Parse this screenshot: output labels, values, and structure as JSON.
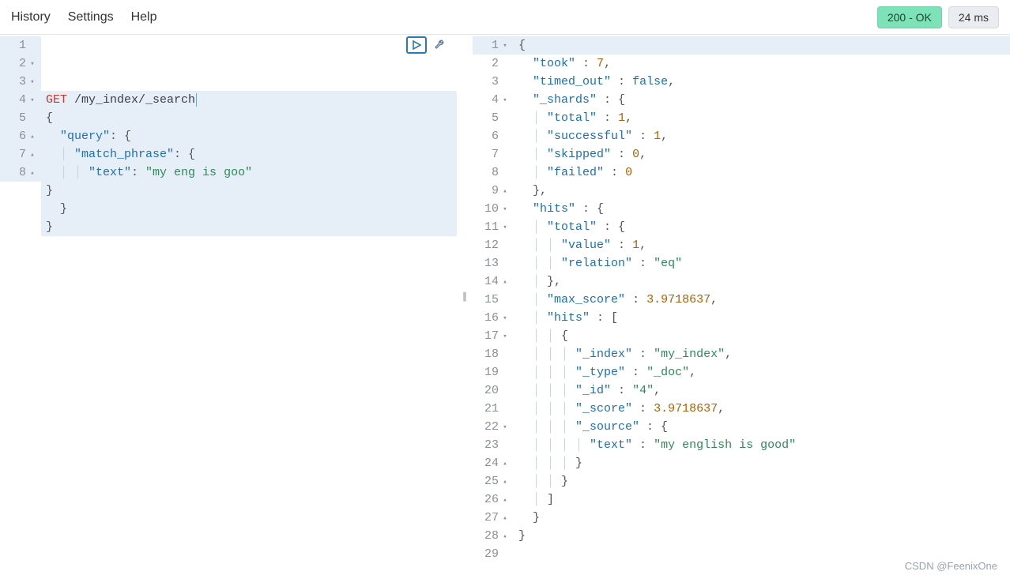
{
  "menu": {
    "history": "History",
    "settings": "Settings",
    "help": "Help"
  },
  "status": {
    "code_label": "200 - OK",
    "time_label": "24 ms"
  },
  "watermark": "CSDN @FeenixOne",
  "request": {
    "method": "GET",
    "path": "/my_index/_search",
    "body_lines": [
      {
        "n": 1,
        "fold": "",
        "hl": true
      },
      {
        "n": 2,
        "fold": "▾",
        "hl": true,
        "text_plain": "{"
      },
      {
        "n": 3,
        "fold": "▾",
        "hl": true,
        "key": "\"query\"",
        "after": ": {"
      },
      {
        "n": 4,
        "fold": "▾",
        "hl": true,
        "indent": 1,
        "key": "\"match_phrase\"",
        "after": ": {"
      },
      {
        "n": 5,
        "fold": "",
        "hl": true,
        "indent": 2,
        "key": "\"text\"",
        "mid": ": ",
        "str": "\"my eng is goo\""
      },
      {
        "n": 6,
        "fold": "▴",
        "hl": true,
        "indent": 1,
        "text_plain": "}"
      },
      {
        "n": 7,
        "fold": "▴",
        "hl": true,
        "text_plain": "  }"
      },
      {
        "n": 8,
        "fold": "▴",
        "hl": true,
        "text_plain": "}"
      }
    ]
  },
  "response": {
    "lines": [
      {
        "n": 1,
        "fold": "▾",
        "hl": true,
        "raw": [
          [
            "punc",
            "{"
          ]
        ]
      },
      {
        "n": 2,
        "fold": "",
        "raw": [
          [
            "punc",
            "  "
          ],
          [
            "key",
            "\"took\""
          ],
          [
            "punc",
            " : "
          ],
          [
            "num",
            "7"
          ],
          [
            "punc",
            ","
          ]
        ]
      },
      {
        "n": 3,
        "fold": "",
        "raw": [
          [
            "punc",
            "  "
          ],
          [
            "key",
            "\"timed_out\""
          ],
          [
            "punc",
            " : "
          ],
          [
            "bool",
            "false"
          ],
          [
            "punc",
            ","
          ]
        ]
      },
      {
        "n": 4,
        "fold": "▾",
        "raw": [
          [
            "punc",
            "  "
          ],
          [
            "key",
            "\"_shards\""
          ],
          [
            "punc",
            " : {"
          ]
        ]
      },
      {
        "n": 5,
        "fold": "",
        "raw": [
          [
            "punc",
            "    "
          ],
          [
            "key",
            "\"total\""
          ],
          [
            "punc",
            " : "
          ],
          [
            "num",
            "1"
          ],
          [
            "punc",
            ","
          ]
        ]
      },
      {
        "n": 6,
        "fold": "",
        "raw": [
          [
            "punc",
            "    "
          ],
          [
            "key",
            "\"successful\""
          ],
          [
            "punc",
            " : "
          ],
          [
            "num",
            "1"
          ],
          [
            "punc",
            ","
          ]
        ]
      },
      {
        "n": 7,
        "fold": "",
        "raw": [
          [
            "punc",
            "    "
          ],
          [
            "key",
            "\"skipped\""
          ],
          [
            "punc",
            " : "
          ],
          [
            "num",
            "0"
          ],
          [
            "punc",
            ","
          ]
        ]
      },
      {
        "n": 8,
        "fold": "",
        "raw": [
          [
            "punc",
            "    "
          ],
          [
            "key",
            "\"failed\""
          ],
          [
            "punc",
            " : "
          ],
          [
            "num",
            "0"
          ]
        ]
      },
      {
        "n": 9,
        "fold": "▴",
        "raw": [
          [
            "punc",
            "  },"
          ]
        ]
      },
      {
        "n": 10,
        "fold": "▾",
        "raw": [
          [
            "punc",
            "  "
          ],
          [
            "key",
            "\"hits\""
          ],
          [
            "punc",
            " : {"
          ]
        ]
      },
      {
        "n": 11,
        "fold": "▾",
        "raw": [
          [
            "punc",
            "    "
          ],
          [
            "key",
            "\"total\""
          ],
          [
            "punc",
            " : {"
          ]
        ]
      },
      {
        "n": 12,
        "fold": "",
        "raw": [
          [
            "punc",
            "      "
          ],
          [
            "key",
            "\"value\""
          ],
          [
            "punc",
            " : "
          ],
          [
            "num",
            "1"
          ],
          [
            "punc",
            ","
          ]
        ]
      },
      {
        "n": 13,
        "fold": "",
        "raw": [
          [
            "punc",
            "      "
          ],
          [
            "key",
            "\"relation\""
          ],
          [
            "punc",
            " : "
          ],
          [
            "str",
            "\"eq\""
          ]
        ]
      },
      {
        "n": 14,
        "fold": "▴",
        "raw": [
          [
            "punc",
            "    },"
          ]
        ]
      },
      {
        "n": 15,
        "fold": "",
        "raw": [
          [
            "punc",
            "    "
          ],
          [
            "key",
            "\"max_score\""
          ],
          [
            "punc",
            " : "
          ],
          [
            "num",
            "3.9718637"
          ],
          [
            "punc",
            ","
          ]
        ]
      },
      {
        "n": 16,
        "fold": "▾",
        "raw": [
          [
            "punc",
            "    "
          ],
          [
            "key",
            "\"hits\""
          ],
          [
            "punc",
            " : ["
          ]
        ]
      },
      {
        "n": 17,
        "fold": "▾",
        "raw": [
          [
            "punc",
            "      {"
          ]
        ]
      },
      {
        "n": 18,
        "fold": "",
        "raw": [
          [
            "punc",
            "        "
          ],
          [
            "key",
            "\"_index\""
          ],
          [
            "punc",
            " : "
          ],
          [
            "str",
            "\"my_index\""
          ],
          [
            "punc",
            ","
          ]
        ]
      },
      {
        "n": 19,
        "fold": "",
        "raw": [
          [
            "punc",
            "        "
          ],
          [
            "key",
            "\"_type\""
          ],
          [
            "punc",
            " : "
          ],
          [
            "str",
            "\"_doc\""
          ],
          [
            "punc",
            ","
          ]
        ]
      },
      {
        "n": 20,
        "fold": "",
        "raw": [
          [
            "punc",
            "        "
          ],
          [
            "key",
            "\"_id\""
          ],
          [
            "punc",
            " : "
          ],
          [
            "str",
            "\"4\""
          ],
          [
            "punc",
            ","
          ]
        ]
      },
      {
        "n": 21,
        "fold": "",
        "raw": [
          [
            "punc",
            "        "
          ],
          [
            "key",
            "\"_score\""
          ],
          [
            "punc",
            " : "
          ],
          [
            "num",
            "3.9718637"
          ],
          [
            "punc",
            ","
          ]
        ]
      },
      {
        "n": 22,
        "fold": "▾",
        "raw": [
          [
            "punc",
            "        "
          ],
          [
            "key",
            "\"_source\""
          ],
          [
            "punc",
            " : {"
          ]
        ]
      },
      {
        "n": 23,
        "fold": "",
        "raw": [
          [
            "punc",
            "          "
          ],
          [
            "key",
            "\"text\""
          ],
          [
            "punc",
            " : "
          ],
          [
            "str",
            "\"my english is good\""
          ]
        ]
      },
      {
        "n": 24,
        "fold": "▴",
        "raw": [
          [
            "punc",
            "        }"
          ]
        ]
      },
      {
        "n": 25,
        "fold": "▴",
        "raw": [
          [
            "punc",
            "      }"
          ]
        ]
      },
      {
        "n": 26,
        "fold": "▴",
        "raw": [
          [
            "punc",
            "    ]"
          ]
        ]
      },
      {
        "n": 27,
        "fold": "▴",
        "raw": [
          [
            "punc",
            "  }"
          ]
        ]
      },
      {
        "n": 28,
        "fold": "▴",
        "raw": [
          [
            "punc",
            "}"
          ]
        ]
      },
      {
        "n": 29,
        "fold": "",
        "raw": []
      }
    ]
  }
}
